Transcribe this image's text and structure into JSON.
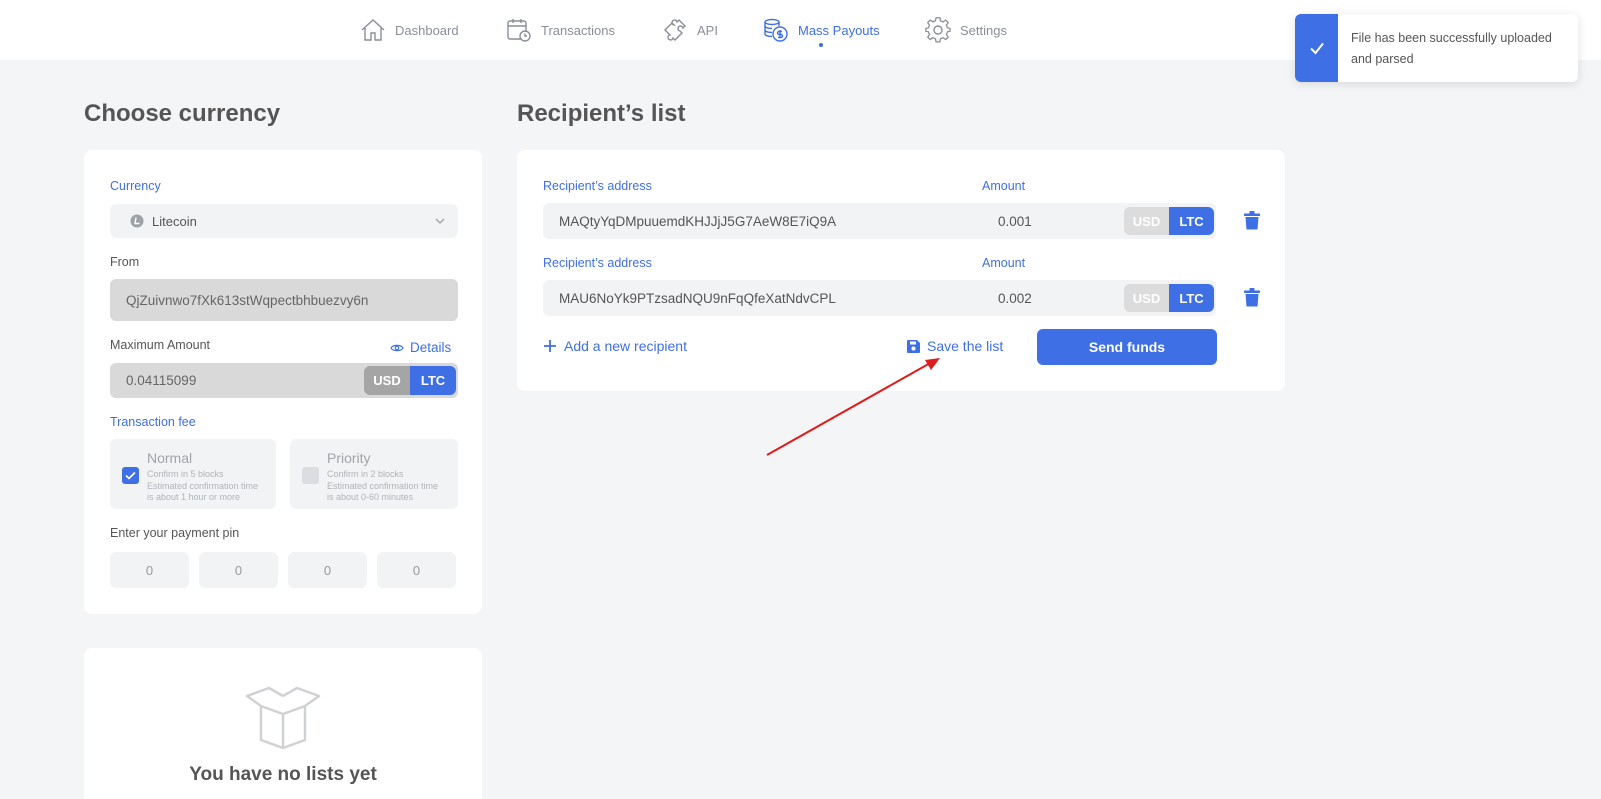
{
  "nav": {
    "items": [
      {
        "label": "Dashboard",
        "icon": "home-icon"
      },
      {
        "label": "Transactions",
        "icon": "calendar-clock-icon"
      },
      {
        "label": "API",
        "icon": "puzzle-icon"
      },
      {
        "label": "Mass Payouts",
        "icon": "coins-icon",
        "active": true
      },
      {
        "label": "Settings",
        "icon": "gear-icon"
      }
    ]
  },
  "toast": {
    "message": "File has been successfully uploaded and parsed"
  },
  "left": {
    "title": "Choose currency",
    "currency_label": "Currency",
    "currency_value": "Litecoin",
    "from_label": "From",
    "from_value": "QjZuivnwo7fXk613stWqpectbhbuezvy6n",
    "max_amount_label": "Maximum Amount",
    "details_label": "Details",
    "max_amount_value": "0.04115099",
    "usd": "USD",
    "ltc": "LTC",
    "fee_label": "Transaction fee",
    "fees": [
      {
        "title": "Normal",
        "line1": "Confirm in 5 blocks",
        "line2": "Estimated confirmation time",
        "line3": "is about 1 hour or more",
        "checked": true
      },
      {
        "title": "Priority",
        "line1": "Confirm in 2 blocks",
        "line2": "Estimated confirmation time",
        "line3": "is about 0-60 minutes",
        "checked": false
      }
    ],
    "pin_label": "Enter your payment pin",
    "pins": [
      "0",
      "0",
      "0",
      "0"
    ]
  },
  "lists": {
    "empty_text": "You have no lists yet"
  },
  "recipients": {
    "title": "Recipient’s list",
    "rows": [
      {
        "address_label": "Recipient’s address",
        "address": "MAQtyYqDMpuuemdKHJJjJ5G7AeW8E7iQ9A",
        "amount_label": "Amount",
        "amount": "0.001",
        "usd": "USD",
        "ltc": "LTC"
      },
      {
        "address_label": "Recipient’s address",
        "address": "MAU6NoYk9PTzsadNQU9nFqQfeXatNdvCPL",
        "amount_label": "Amount",
        "amount": "0.002",
        "usd": "USD",
        "ltc": "LTC"
      }
    ],
    "add_label": "Add a new recipient",
    "save_label": "Save the list",
    "send_label": "Send funds"
  },
  "colors": {
    "accent": "#3f6fe4",
    "annotation_arrow": "#e01b1b"
  }
}
